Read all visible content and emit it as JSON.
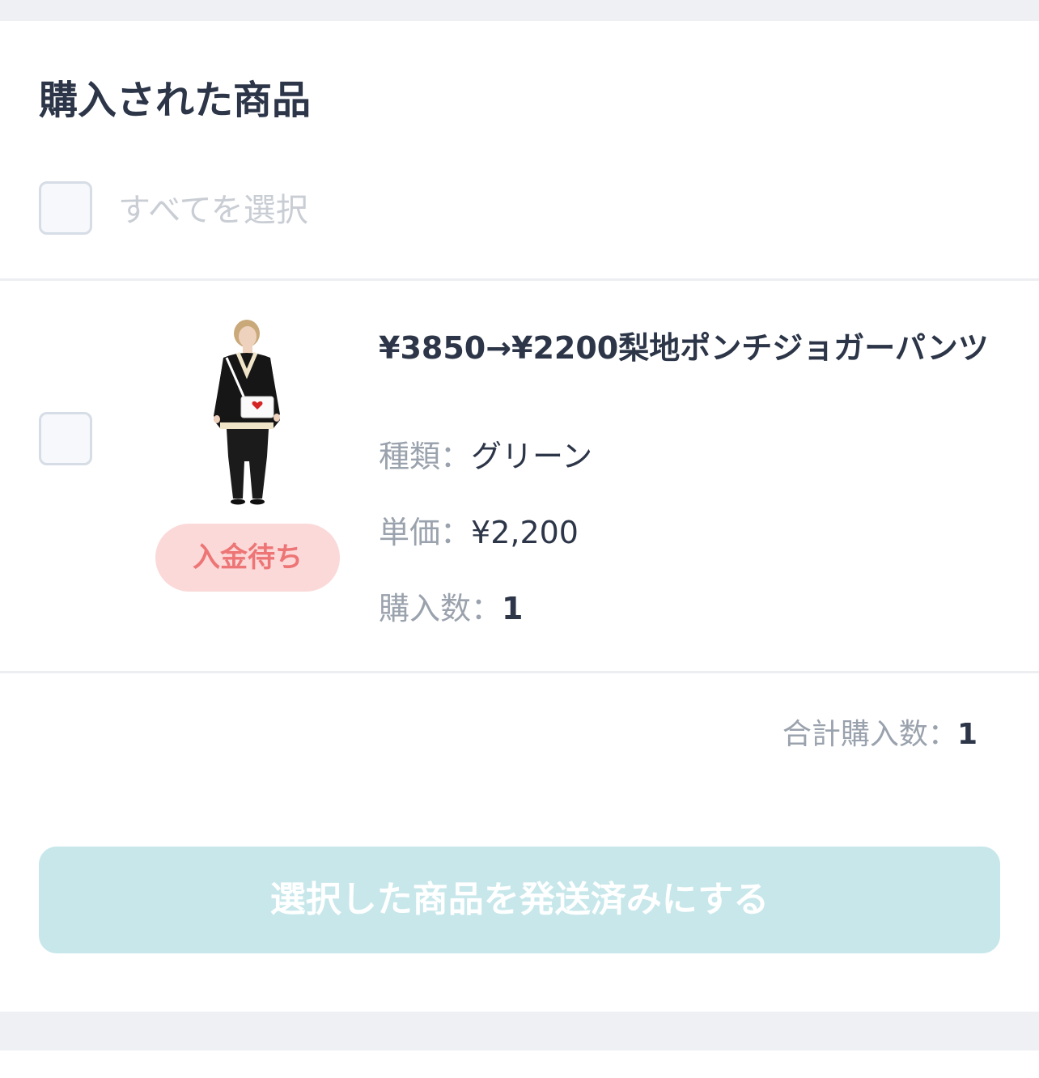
{
  "section": {
    "title": "購入された商品",
    "select_all_label": "すべてを選択"
  },
  "item": {
    "name": "¥3850→¥2200梨地ポンチジョガーパンツ",
    "status": "入金待ち",
    "variant_label": "種類：",
    "variant_value": "グリーン",
    "unit_price_label": "単価：",
    "unit_price_value": "¥2,200",
    "quantity_label": "購入数：",
    "quantity_value": "1"
  },
  "summary": {
    "total_quantity_label": "合計購入数：",
    "total_quantity_value": "1"
  },
  "actions": {
    "mark_shipped_label": "選択した商品を発送済みにする"
  },
  "colors": {
    "text_primary": "#2c3648",
    "text_muted": "#9aa2ad",
    "badge_bg": "#fbd9d9",
    "badge_text": "#ee7575",
    "button_bg": "#c7e7ea",
    "page_band": "#eef0f4"
  }
}
